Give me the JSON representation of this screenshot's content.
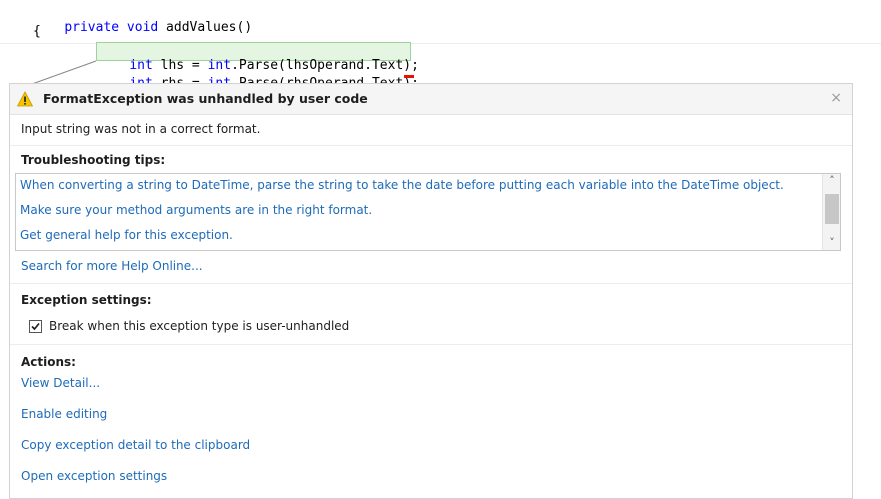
{
  "code": {
    "line1": {
      "kw": "private void",
      "rest": " addValues()"
    },
    "line2": "{",
    "line3": {
      "kw1": "int",
      "p1": " lhs = ",
      "kw2": "int",
      "p2": ".Parse(lhsOperand.Text);"
    },
    "line4": {
      "kw1": "int",
      "p1": " rhs = ",
      "kw2": "int",
      "p2": ".Parse(rhsOperand.Text);"
    }
  },
  "exception": {
    "title": "FormatException was unhandled by user code",
    "message": "Input string was not in a correct format.",
    "close_glyph": "×",
    "icon": "warning-icon"
  },
  "troubleshooting": {
    "heading": "Troubleshooting tips:",
    "tips": [
      "When converting a string to DateTime, parse the string to take the date before putting each variable into the DateTime object.",
      "Make sure your method arguments are in the right format.",
      "Get general help for this exception."
    ],
    "search_link": "Search for more Help Online..."
  },
  "settings": {
    "heading": "Exception settings:",
    "checkbox_label": "Break when this exception type is user-unhandled",
    "checked": true
  },
  "actions": {
    "heading": "Actions:",
    "items": [
      "View Detail...",
      "Enable editing",
      "Copy exception detail to the clipboard",
      "Open exception settings"
    ]
  },
  "colors": {
    "link": "#1e6bb8",
    "keyword": "#0000ff",
    "warning": "#f5c400",
    "highlight": "#e4f5e1",
    "error": "#e51400"
  }
}
